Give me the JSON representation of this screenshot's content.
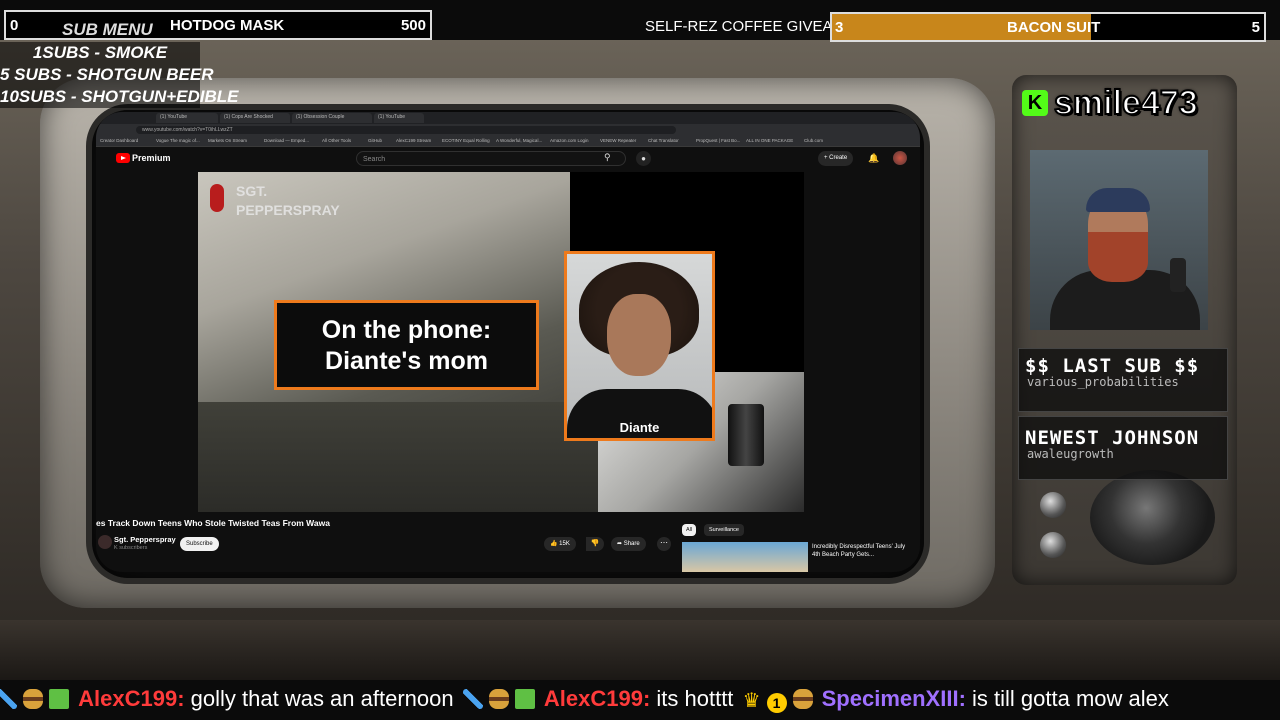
{
  "overlay": {
    "submenu_bar": {
      "left_count": "0",
      "title": "SUB MENU",
      "goal_label": "HOTDOG MASK",
      "goal_target": "500"
    },
    "submenu_items": [
      "1SUBS   - SMOKE",
      "5 SUBS  - SHOTGUN BEER",
      "10SUBS - SHOTGUN+EDIBLE"
    ],
    "coffee_text": "SELF-REZ COFFEE GIVEAW.",
    "bacon_bar": {
      "current": "3",
      "label": "BACON SUIT",
      "target": "5",
      "progress": 0.6,
      "fill_color": "#c8861b"
    },
    "streamer_name": "smile473",
    "kick_logo_letter": "K",
    "kick_color": "#53fc18",
    "last_sub": {
      "title": "$$ LAST SUB $$",
      "value": "various_probabilities"
    },
    "newest_johnson": {
      "title": "NEWEST JOHNSON",
      "value": "awaleugrowth"
    }
  },
  "browser": {
    "tabs": [
      "(1) YouTube",
      "(1) Cops Are Shocked",
      "(1) Obsession Couple",
      "(1) YouTube"
    ],
    "url": "www.youtube.com/watch?v=T0ihLLwzZT",
    "bookmarks": [
      "Creator Dashboard",
      "Vogue The magic of...",
      "Markets On Stream",
      "Download — Emped...",
      "All Other Tools",
      "GitHub",
      "AlexC199 Stream",
      "ECOTINY Equal Rolling",
      "A Wonderful, Magical...",
      "Amazon.com Login",
      "VENEW Repeater",
      "Chat Translator",
      "PropQuest | Fast Bo...",
      "ALL IN ONE PACKAGE",
      "Club.com"
    ]
  },
  "youtube": {
    "premium_label": "Premium",
    "search_placeholder": "Search",
    "create_label": "Create",
    "video": {
      "watermark": "SGT.\nPEPPERSPRAY",
      "caption": "On the phone:\nDiante's mom",
      "mugshot_name": "Diante"
    },
    "title": "es Track Down Teens Who Stole Twisted Teas From Wawa",
    "channel": "Sgt. Pepperspray",
    "subscribers": "K subscribers",
    "subscribe_label": "Subscribe",
    "likes": "15K",
    "share_label": "Share",
    "chips": [
      "All",
      "Surveillance"
    ],
    "recommendation_title": "Incredibly Disrespectful Teens' July 4th Beach Party Gets..."
  },
  "chat": [
    {
      "user": "AlexC199",
      "message": "golly that was an afternoon",
      "color": "#ff3b3b"
    },
    {
      "user": "AlexC199",
      "message": "its hotttt",
      "color": "#ff3b3b"
    },
    {
      "user": "SpecimenXIII",
      "message": "is till gotta mow alex",
      "color": "#a070ff"
    }
  ],
  "icons": [
    "search-icon",
    "mic-icon",
    "bell-icon",
    "like-icon",
    "dislike-icon",
    "share-icon",
    "more-icon",
    "crown-icon",
    "burger-emote",
    "gift-emote",
    "sword-emote"
  ]
}
